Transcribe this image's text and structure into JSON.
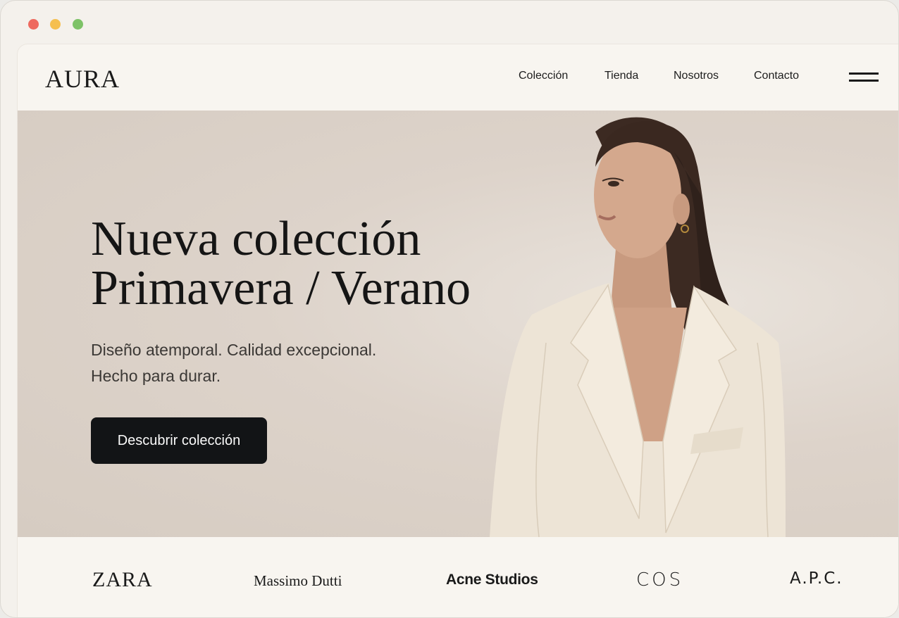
{
  "window": {
    "controls": [
      "close",
      "minimize",
      "zoom"
    ],
    "colors": {
      "close": "#ee6a5f",
      "minimize": "#f5bf4f",
      "zoom": "#7dc267"
    }
  },
  "header": {
    "logo": "AURA",
    "nav": [
      {
        "label": "Colección"
      },
      {
        "label": "Tienda"
      },
      {
        "label": "Nosotros"
      },
      {
        "label": "Contacto"
      }
    ],
    "menu_icon": "hamburger-menu-icon"
  },
  "hero": {
    "title_line1": "Nueva colección",
    "title_line2": "Primavera / Verano",
    "subtitle_line1": "Diseño atemporal. Calidad excepcional.",
    "subtitle_line2": "Hecho para durar.",
    "cta_label": "Descubrir colección",
    "image": "woman-in-cream-blazer-photo"
  },
  "brands": [
    "ZARA",
    "Massimo Dutti",
    "Acne Studios",
    "COS",
    "A.P.C."
  ],
  "colors": {
    "background": "#f8f5f0",
    "hero_background": "#d9cfc6",
    "cta_background": "#121416",
    "text": "#1a1a1a"
  }
}
